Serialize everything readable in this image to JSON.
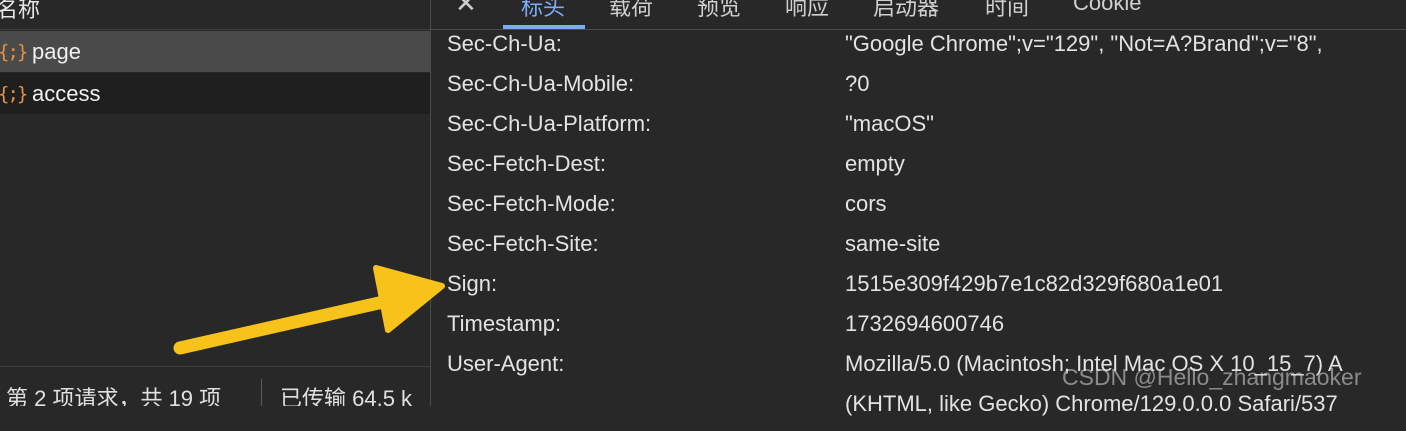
{
  "left_panel": {
    "column_header": "名称",
    "requests": [
      {
        "icon": "{;}",
        "name": "page"
      },
      {
        "icon": "{;}",
        "name": "access"
      }
    ],
    "footer": {
      "request_count": "第 2 项请求，共 19 项",
      "transferred": "已传输 64.5 k"
    }
  },
  "tabs": {
    "close": "✕",
    "items": [
      "标头",
      "载荷",
      "预览",
      "响应",
      "启动器",
      "时间",
      "Cookie"
    ],
    "active": "标头"
  },
  "request_headers": [
    {
      "name": "Sec-Ch-Ua:",
      "value": "\"Google Chrome\";v=\"129\", \"Not=A?Brand\";v=\"8\","
    },
    {
      "name": "Sec-Ch-Ua-Mobile:",
      "value": "?0"
    },
    {
      "name": "Sec-Ch-Ua-Platform:",
      "value": "\"macOS\""
    },
    {
      "name": "Sec-Fetch-Dest:",
      "value": "empty"
    },
    {
      "name": "Sec-Fetch-Mode:",
      "value": "cors"
    },
    {
      "name": "Sec-Fetch-Site:",
      "value": "same-site"
    },
    {
      "name": "Sign:",
      "value": "1515e309f429b7e1c82d329f680a1e01"
    },
    {
      "name": "Timestamp:",
      "value": "1732694600746"
    },
    {
      "name": "User-Agent:",
      "value": "Mozilla/5.0 (Macintosh; Intel Mac OS X 10_15_7) A"
    },
    {
      "name": "",
      "value": "(KHTML, like Gecko) Chrome/129.0.0.0 Safari/537"
    }
  ],
  "watermark": "CSDN @Hello_zhangmaoker",
  "colors": {
    "background": "#282828",
    "accent_tab": "#7cacf8",
    "icon_orange": "#e8913f",
    "annotation_arrow": "#f7c31a"
  }
}
